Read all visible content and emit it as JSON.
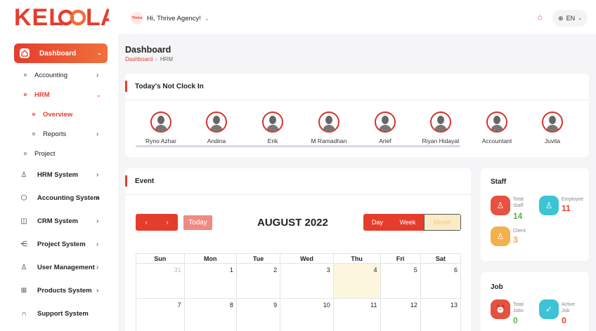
{
  "brand": {
    "logo_text": "KELOOLA",
    "accent": "#e53d2d"
  },
  "header": {
    "agency_logo": "Thrive",
    "greeting": "Hi, Thrive Agency!",
    "language": "EN"
  },
  "sidebar": {
    "dashboard": "Dashboard",
    "items": [
      {
        "label": "Accounting"
      },
      {
        "label": "HRM"
      },
      {
        "label": "Overview"
      },
      {
        "label": "Reports"
      },
      {
        "label": "Project"
      },
      {
        "label": "HRM System",
        "icon": "person-icon"
      },
      {
        "label": "Accounting System",
        "icon": "box-icon"
      },
      {
        "label": "CRM System",
        "icon": "layers-icon"
      },
      {
        "label": "Project System",
        "icon": "share-icon"
      },
      {
        "label": "User Management",
        "icon": "users-icon"
      },
      {
        "label": "Products System",
        "icon": "cart-icon"
      },
      {
        "label": "Support System",
        "icon": "headset-icon"
      }
    ]
  },
  "page": {
    "title": "Dashboard",
    "breadcrumb": [
      "Dashboard",
      "HRM"
    ]
  },
  "clock": {
    "title": "Today's Not Clock In",
    "people": [
      "Ryno Azhar",
      "Andina",
      "Erik",
      "M Ramadhan",
      "Arief",
      "Riyan Hidayat",
      "Accountant",
      "Juvita"
    ]
  },
  "event": {
    "title": "Event",
    "prev": "‹",
    "next": "›",
    "today": "Today",
    "month": "AUGUST 2022",
    "views": [
      "Day",
      "Week",
      "Month"
    ],
    "weekdays": [
      "Sun",
      "Mon",
      "Tue",
      "Wed",
      "Thu",
      "Fri",
      "Sat"
    ],
    "week1": [
      "31",
      "1",
      "2",
      "3",
      "4",
      "5",
      "6"
    ],
    "week2": [
      "7",
      "8",
      "9",
      "10",
      "11",
      "12",
      "13"
    ]
  },
  "staff": {
    "title": "Staff",
    "total_label": "Total Staff",
    "total": "14",
    "employee_label": "Employee",
    "employee": "11",
    "client_label": "Client",
    "client": "3"
  },
  "job": {
    "title": "Job",
    "total_label": "Total Jobs",
    "total": "0",
    "active_label": "Active Job",
    "active": "0"
  }
}
